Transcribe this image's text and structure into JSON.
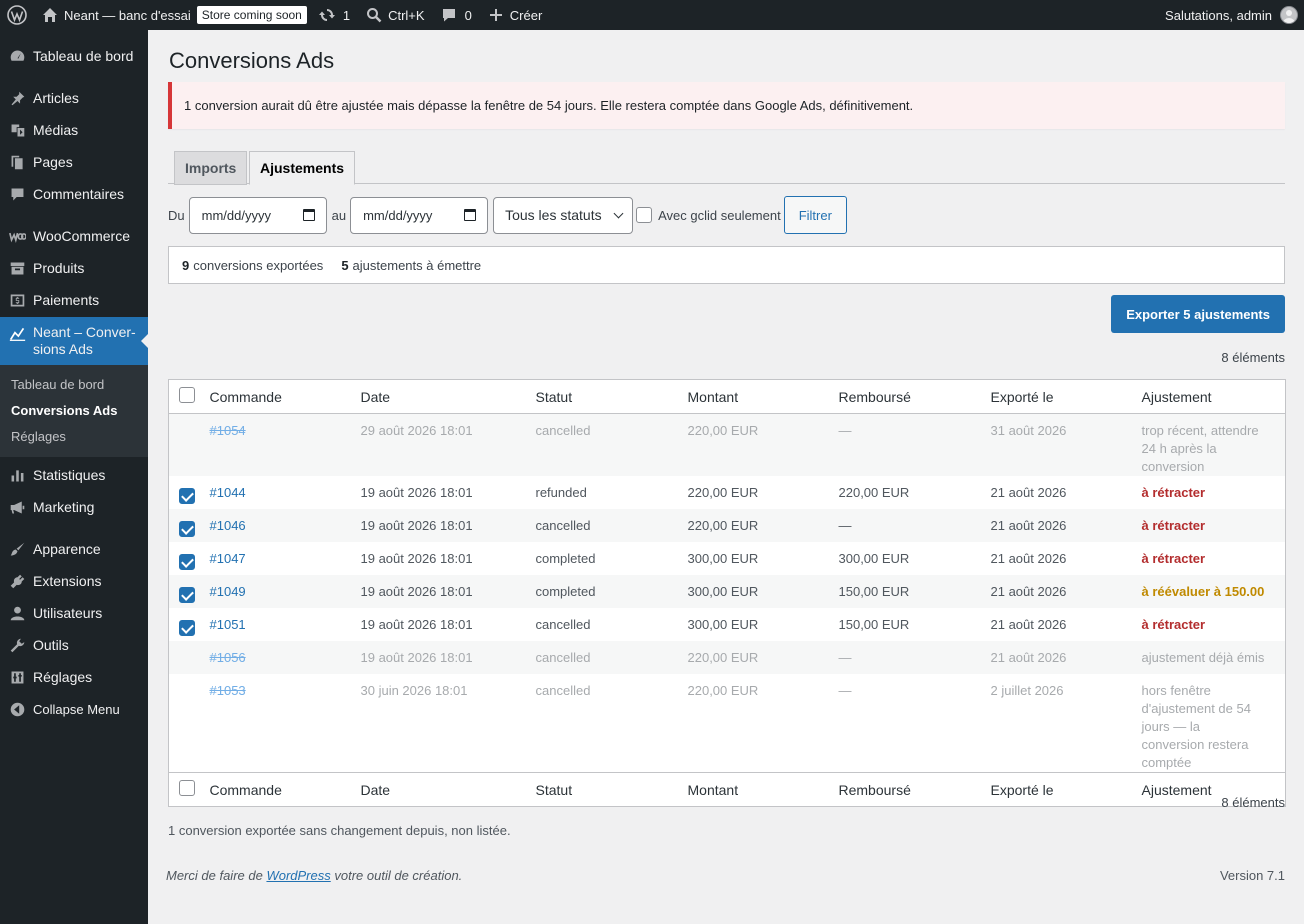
{
  "admin_bar": {
    "site_name": "Neant — banc d'essai",
    "store_badge": "Store coming soon",
    "updates_count": "1",
    "search_shortcut": "Ctrl+K",
    "comments_count": "0",
    "new_label": "Créer",
    "greeting": "Salutations, admin"
  },
  "menu": {
    "dashboard": "Tableau de bord",
    "posts": "Articles",
    "media": "Médias",
    "pages": "Pages",
    "comments": "Commentaires",
    "woocommerce": "WooCommerce",
    "products": "Produits",
    "payments": "Paiements",
    "current_line1": "Neant – Conver-",
    "current_line2": "sions Ads",
    "sub_dashboard": "Tableau de bord",
    "sub_conversions": "Conversions Ads",
    "sub_settings": "Réglages",
    "stats": "Statistiques",
    "marketing": "Marketing",
    "appearance": "Apparence",
    "extensions": "Extensions",
    "users": "Utilisateurs",
    "tools": "Outils",
    "settings": "Réglages",
    "collapse": "Collapse Menu"
  },
  "page": {
    "title": "Conversions Ads",
    "notice": "1 conversion aurait dû être ajustée mais dépasse la fenêtre de 54 jours. Elle restera comptée dans Google Ads, définitivement.",
    "tabs": [
      "Imports",
      "Ajustements"
    ]
  },
  "filters": {
    "from_label": "Du",
    "to_label": "au",
    "date_placeholder": "mm/dd/yyyy",
    "status_select": "Tous les statuts",
    "gclid_label": "Avec gclid seulement",
    "filter_button": "Filtrer"
  },
  "summary": {
    "exported_count": "9",
    "exported_label": "conversions exportées",
    "adjust_count": "5",
    "adjust_label": "ajustements à émettre"
  },
  "export_button": "Exporter 5 ajustements",
  "items_count": "8 éléments",
  "table": {
    "headers": [
      "Commande",
      "Date",
      "Statut",
      "Montant",
      "Remboursé",
      "Exporté le",
      "Ajustement"
    ],
    "rows": [
      {
        "order": "#1054",
        "date": "29 août 2026 18:01",
        "status": "cancelled",
        "amount": "220,00 EUR",
        "refunded": "—",
        "exported": "31 août 2026",
        "adjustment": "trop récent, attendre 24 h après la conversion"
      },
      {
        "order": "#1044",
        "date": "19 août 2026 18:01",
        "status": "refunded",
        "amount": "220,00 EUR",
        "refunded": "220,00 EUR",
        "exported": "21 août 2026",
        "adjustment": "à rétracter"
      },
      {
        "order": "#1046",
        "date": "19 août 2026 18:01",
        "status": "cancelled",
        "amount": "220,00 EUR",
        "refunded": "—",
        "exported": "21 août 2026",
        "adjustment": "à rétracter"
      },
      {
        "order": "#1047",
        "date": "19 août 2026 18:01",
        "status": "completed",
        "amount": "300,00 EUR",
        "refunded": "300,00 EUR",
        "exported": "21 août 2026",
        "adjustment": "à rétracter"
      },
      {
        "order": "#1049",
        "date": "19 août 2026 18:01",
        "status": "completed",
        "amount": "300,00 EUR",
        "refunded": "150,00 EUR",
        "exported": "21 août 2026",
        "adjustment": "à réévaluer à 150.00"
      },
      {
        "order": "#1051",
        "date": "19 août 2026 18:01",
        "status": "cancelled",
        "amount": "300,00 EUR",
        "refunded": "150,00 EUR",
        "exported": "21 août 2026",
        "adjustment": "à rétracter"
      },
      {
        "order": "#1056",
        "date": "19 août 2026 18:01",
        "status": "cancelled",
        "amount": "220,00 EUR",
        "refunded": "—",
        "exported": "21 août 2026",
        "adjustment": "ajustement déjà émis"
      },
      {
        "order": "#1053",
        "date": "30 juin 2026 18:01",
        "status": "cancelled",
        "amount": "220,00 EUR",
        "refunded": "—",
        "exported": "2 juillet 2026",
        "adjustment": "hors fenêtre d'ajustement de 54 jours — la conversion restera comptée"
      }
    ]
  },
  "footnote": "1 conversion exportée sans changement depuis, non listée.",
  "footer": {
    "thanks_prefix": "Merci de faire de",
    "thanks_link": "WordPress",
    "thanks_suffix": "votre outil de création.",
    "version": "Version 7.1"
  }
}
